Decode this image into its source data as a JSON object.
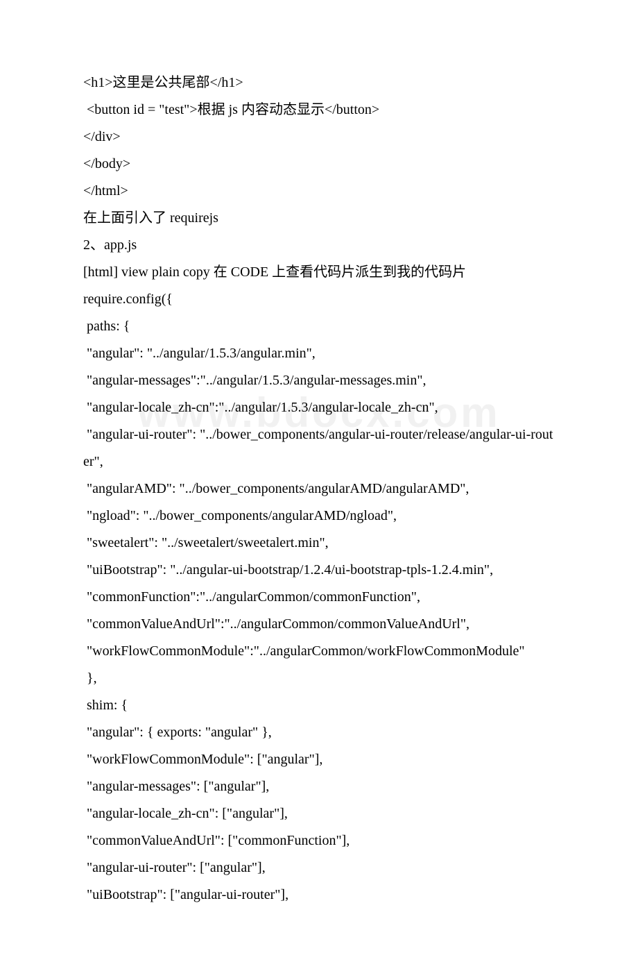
{
  "watermark": "www.bdocx.com",
  "lines": [
    "<h1>这里是公共尾部</h1>",
    " <button id = \"test\">根据 js 内容动态显示</button>",
    "</div>",
    "</body>",
    "</html>",
    "在上面引入了 requirejs",
    "2、app.js",
    "[html] view plain copy 在 CODE 上查看代码片派生到我的代码片",
    "require.config({",
    " paths: {",
    " \"angular\": \"../angular/1.5.3/angular.min\",",
    " \"angular-messages\":\"../angular/1.5.3/angular-messages.min\",",
    " \"angular-locale_zh-cn\":\"../angular/1.5.3/angular-locale_zh-cn\",",
    " \"angular-ui-router\": \"../bower_components/angular-ui-router/release/angular-ui-router\",",
    " \"angularAMD\": \"../bower_components/angularAMD/angularAMD\",",
    " \"ngload\": \"../bower_components/angularAMD/ngload\",",
    " \"sweetalert\": \"../sweetalert/sweetalert.min\",",
    " \"uiBootstrap\": \"../angular-ui-bootstrap/1.2.4/ui-bootstrap-tpls-1.2.4.min\",",
    " \"commonFunction\":\"../angularCommon/commonFunction\",",
    " \"commonValueAndUrl\":\"../angularCommon/commonValueAndUrl\",",
    " \"workFlowCommonModule\":\"../angularCommon/workFlowCommonModule\"",
    " },",
    " shim: {",
    " \"angular\": { exports: \"angular\" },",
    " \"workFlowCommonModule\": [\"angular\"],",
    " \"angular-messages\": [\"angular\"],",
    " \"angular-locale_zh-cn\": [\"angular\"],",
    " \"commonValueAndUrl\": [\"commonFunction\"],",
    " \"angular-ui-router\": [\"angular\"],",
    " \"uiBootstrap\": [\"angular-ui-router\"],"
  ]
}
